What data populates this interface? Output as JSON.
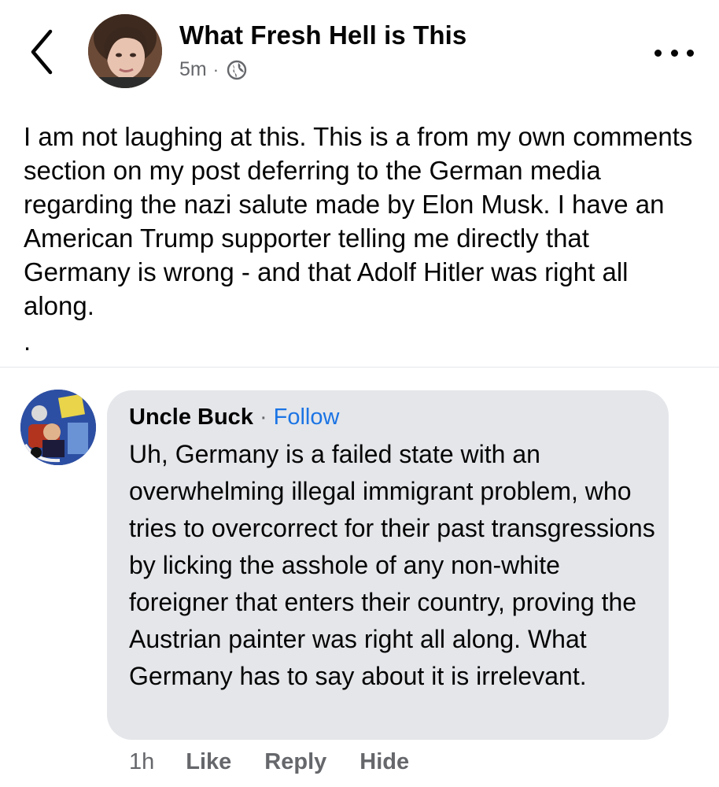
{
  "header": {
    "page_name": "What Fresh Hell is This",
    "time": "5m",
    "dot": "·",
    "back_icon": "chevron-left-icon",
    "privacy_icon": "globe-icon",
    "more_icon": "more-horizontal-icon"
  },
  "post": {
    "text": "I am not laughing at this. This is a from my own comments section on my post deferring to the German media regarding the nazi salute made by Elon Musk. I have an American Trump supporter telling me directly that Germany is wrong - and that Adolf Hitler was right all along.",
    "trailing_dot": "."
  },
  "comment": {
    "author": "Uncle Buck",
    "separator": "·",
    "follow_label": "Follow",
    "text": "Uh, Germany is a failed state with an overwhelming illegal immigrant problem, who tries to overcorrect for their past transgressions by licking the asshole of any non-white foreigner that enters their country, proving the Austrian painter was right all along. What Germany has to say about it is irrelevant.",
    "time": "1h",
    "like_label": "Like",
    "reply_label": "Reply",
    "hide_label": "Hide"
  },
  "colors": {
    "link_blue": "#1b74e4",
    "bubble_gray": "#e4e6ea",
    "secondary_text": "#65676b"
  }
}
